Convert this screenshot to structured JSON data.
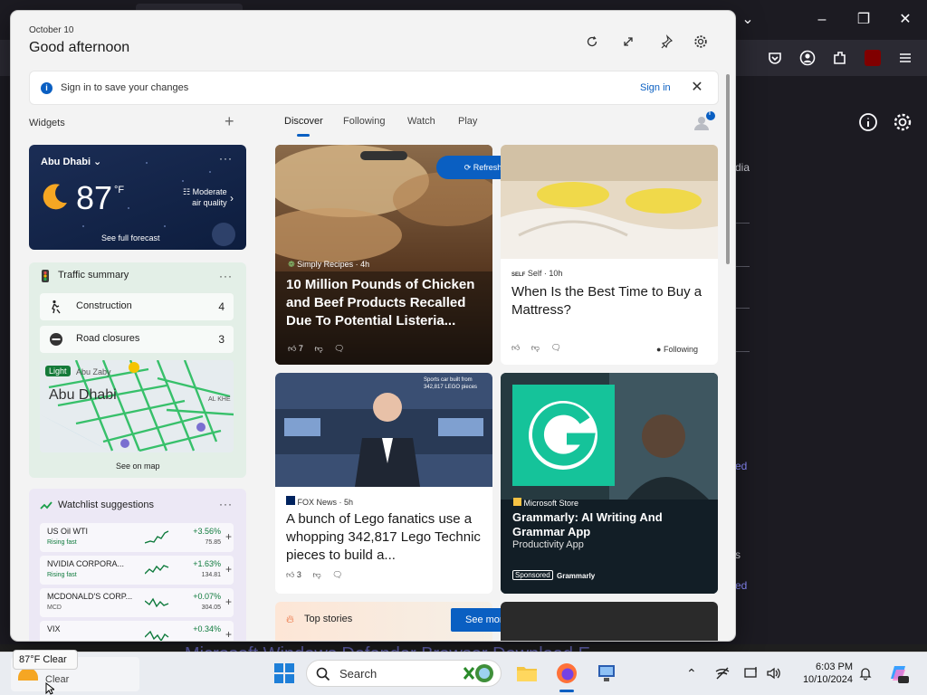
{
  "browser": {
    "side_text": "dia",
    "side_links": [
      "ed",
      "s",
      "ed"
    ]
  },
  "panel": {
    "date": "October 10",
    "greeting": "Good afternoon",
    "signin_text": "Sign in to save your changes",
    "signin_link": "Sign in",
    "widgets_label": "Widgets",
    "avatar_badge": "i",
    "tabs": [
      "Discover",
      "Following",
      "Watch",
      "Play"
    ]
  },
  "weather": {
    "city": "Abu Dhabi",
    "temp": "87",
    "unit": "°F",
    "air_quality_1": "Moderate",
    "air_quality_2": "air quality",
    "forecast_link": "See full forecast"
  },
  "traffic": {
    "title": "Traffic summary",
    "rows": [
      {
        "label": "Construction",
        "count": "4"
      },
      {
        "label": "Road closures",
        "count": "3"
      }
    ],
    "map_badge": "Light",
    "map_city": "Abu Dhabi",
    "map_small": "Abu Zaby",
    "map_label_right": "AL KHE",
    "see_map": "See on map"
  },
  "watchlist": {
    "title": "Watchlist suggestions",
    "items": [
      {
        "name": "US Oil WTI",
        "sub": "Rising fast",
        "change": "+3.56%",
        "value": "75.85"
      },
      {
        "name": "NVIDIA CORPORA...",
        "sub": "Rising fast",
        "change": "+1.63%",
        "value": "134.81"
      },
      {
        "name": "MCDONALD'S CORP...",
        "sub": "MCD",
        "change": "+0.07%",
        "value": "304.05"
      },
      {
        "name": "VIX",
        "sub": "",
        "change": "+0.34%",
        "value": ""
      }
    ]
  },
  "feed": {
    "refresh": "Refresh stories",
    "cards": [
      {
        "source": "Simply Recipes · 4h",
        "headline": "10 Million Pounds of Chicken and Beef Products Recalled Due To Potential Listeria...",
        "likes": "7"
      },
      {
        "source": "Self · 10h",
        "source_logo": "SELF",
        "headline": "When Is the Best Time to Buy a Mattress?",
        "following": "Following"
      },
      {
        "source": "FOX News · 5h",
        "headline": "A bunch of Lego fanatics use a whopping 342,817 Lego Technic pieces to build a...",
        "likes": "3",
        "overlay": "Sports car built from 342,817 LEGO pieces"
      },
      {
        "source": "Microsoft Store",
        "headline": "Grammarly: AI Writing And Grammar App",
        "sub": "Productivity App",
        "sponsored": "Sponsored",
        "brand": "Grammarly"
      }
    ],
    "top_stories": "Top stories",
    "see_more": "See more"
  },
  "taskbar": {
    "tooltip": "87°F Clear",
    "weather_text": "Clear",
    "search": "Search",
    "time": "6:03 PM",
    "date": "10/10/2024"
  },
  "ghost_text": "Microsoft Windows Defender Browser Download E",
  "colors": {
    "accent": "#0a5fc2",
    "weather_bg": "#1b2d55",
    "traffic_bg": "#e3efe7",
    "watchlist_bg": "#ece8f5",
    "gain": "#0e7a3c"
  }
}
